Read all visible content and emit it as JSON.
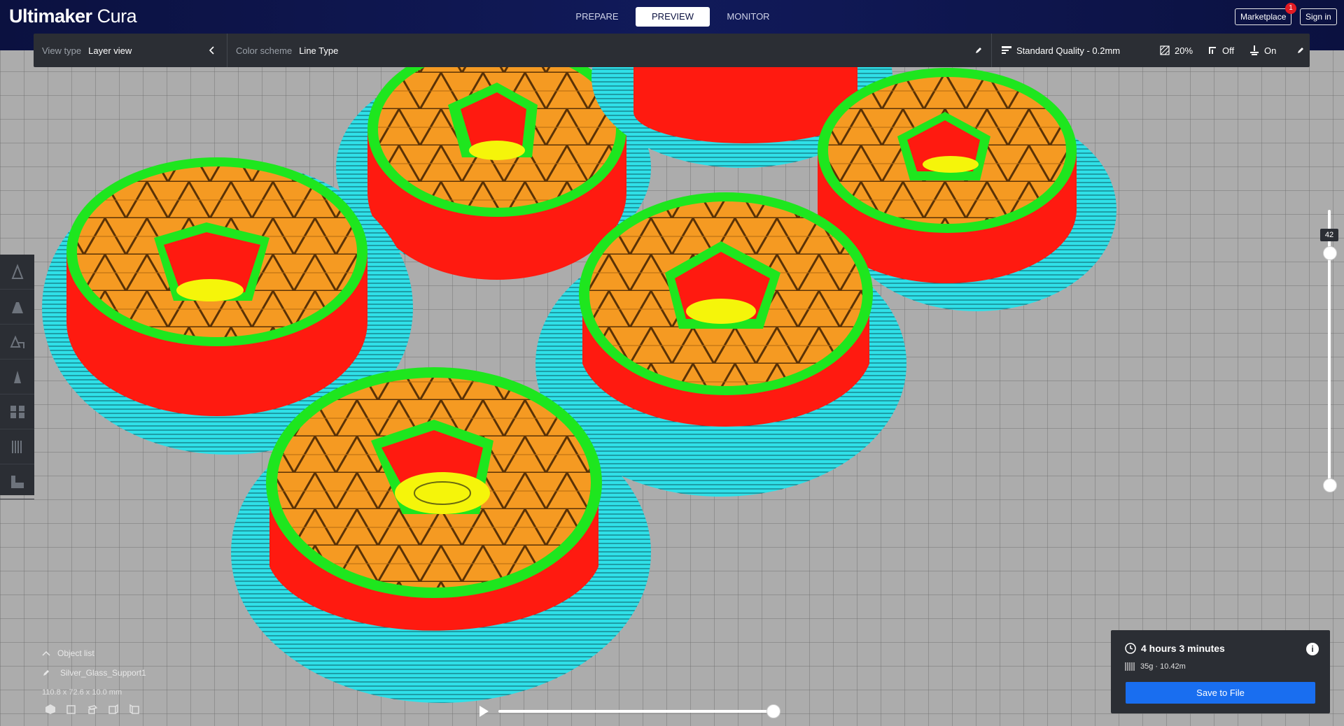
{
  "app": {
    "brand": "Ultimaker",
    "product": "Cura"
  },
  "stages": [
    {
      "label": "PREPARE",
      "active": false
    },
    {
      "label": "PREVIEW",
      "active": true
    },
    {
      "label": "MONITOR",
      "active": false
    }
  ],
  "header": {
    "marketplace": "Marketplace",
    "marketplace_badge": "1",
    "sign_in": "Sign in"
  },
  "toolbar": {
    "view_type_label": "View type",
    "view_type_value": "Layer view",
    "color_scheme_label": "Color scheme",
    "color_scheme_value": "Line Type",
    "quality": "Standard Quality - 0.2mm",
    "infill": "20%",
    "support": "Off",
    "adhesion": "On"
  },
  "left_tools": [
    "move-tool-icon",
    "scale-tool-icon",
    "rotate-tool-icon",
    "mirror-tool-icon",
    "per-model-settings-icon",
    "support-blocker-icon",
    "layer-icon"
  ],
  "layer_slider": {
    "current_layer": "42"
  },
  "object_list": {
    "title": "Object list",
    "object_name": "Silver_Glass_Support1",
    "dimensions": "110.8 x 72.6 x 10.0 mm"
  },
  "print_info": {
    "time": "4 hours 3 minutes",
    "material": "35g · 10.42m",
    "save_button": "Save to File"
  },
  "colors": {
    "header_bg": "#0b1140",
    "panel_bg": "#2b2e34",
    "accent_blue": "#196ef0",
    "wall_red": "#ff1a10",
    "skin_green": "#1ee61e",
    "infill_orange": "#f59a22",
    "skirt_cyan": "#2fe0e8",
    "support_yellow": "#f5f50a"
  }
}
